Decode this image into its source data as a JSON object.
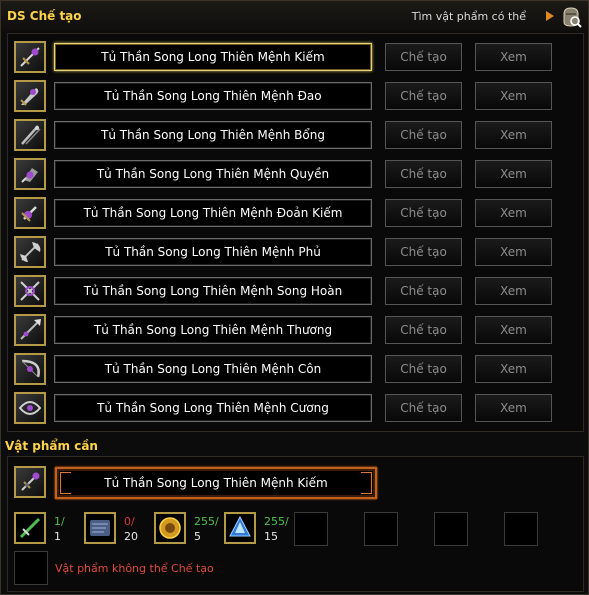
{
  "header": {
    "title": "DS Chế tạo",
    "search_label": "Tìm vật phẩm có thể"
  },
  "recipes": [
    {
      "name": "Tủ Thần Song Long Thiên Mệnh Kiếm",
      "craft_label": "Chế tạo",
      "view_label": "Xem",
      "icon": "sword-icon",
      "selected": true
    },
    {
      "name": "Tủ Thần Song Long Thiên Mệnh Đao",
      "craft_label": "Chế tạo",
      "view_label": "Xem",
      "icon": "blade-icon"
    },
    {
      "name": "Tủ Thần Song Long Thiên Mệnh Bổng",
      "craft_label": "Chế tạo",
      "view_label": "Xem",
      "icon": "staff-icon"
    },
    {
      "name": "Tủ Thần Song Long Thiên Mệnh Quyền",
      "craft_label": "Chế tạo",
      "view_label": "Xem",
      "icon": "fist-icon"
    },
    {
      "name": "Tủ Thần Song Long Thiên Mệnh Đoản Kiếm",
      "craft_label": "Chế tạo",
      "view_label": "Xem",
      "icon": "dagger-icon"
    },
    {
      "name": "Tủ Thần Song Long Thiên Mệnh Phủ",
      "craft_label": "Chế tạo",
      "view_label": "Xem",
      "icon": "axe-icon"
    },
    {
      "name": "Tủ Thần Song Long Thiên Mệnh Song Hoàn",
      "craft_label": "Chế tạo",
      "view_label": "Xem",
      "icon": "twin-rings-icon"
    },
    {
      "name": "Tủ Thần Song Long Thiên Mệnh Thương",
      "craft_label": "Chế tạo",
      "view_label": "Xem",
      "icon": "spear-icon"
    },
    {
      "name": "Tủ Thần Song Long Thiên Mệnh Côn",
      "craft_label": "Chế tạo",
      "view_label": "Xem",
      "icon": "bow-icon"
    },
    {
      "name": "Tủ Thần Song Long Thiên Mệnh Cương",
      "craft_label": "Chế tạo",
      "view_label": "Xem",
      "icon": "chakram-icon"
    }
  ],
  "required": {
    "label": "Vật phẩm cần",
    "item_name": "Tủ Thần Song Long Thiên Mệnh Kiếm",
    "materials": [
      {
        "icon": "green-blade-icon",
        "have": "1/",
        "need": "1",
        "have_color": "#4fc04f"
      },
      {
        "icon": "scroll-icon",
        "have": "0/",
        "need": "20",
        "have_color": "#d23a3a"
      },
      {
        "icon": "gold-coin-icon",
        "have": "255/",
        "need": "5",
        "have_color": "#4fc04f"
      },
      {
        "icon": "crystal-icon",
        "have": "255/",
        "need": "15",
        "have_color": "#4fc04f"
      }
    ],
    "empty_slots": 4,
    "fail_text": "Vật phẩm không thể Chế tạo"
  },
  "colors": {
    "title": "#ffd24a",
    "frame_gold": "#b49a46",
    "selected_border": "#e8d27a",
    "required_border": "#c0621c",
    "fail_text": "#e04a3a"
  }
}
